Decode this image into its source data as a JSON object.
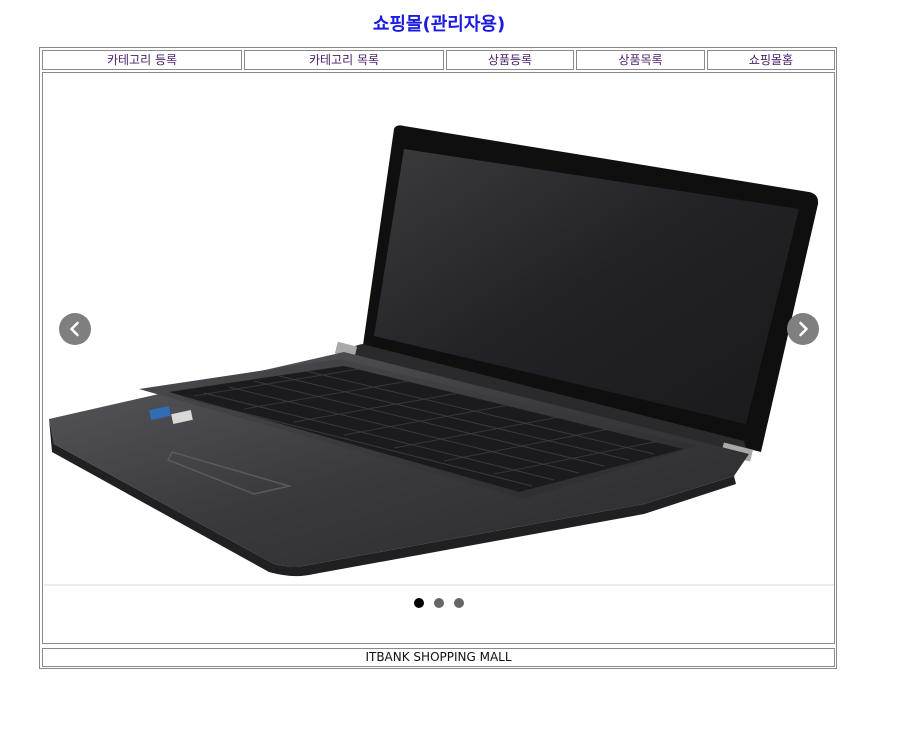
{
  "header": {
    "title": "쇼핑몰(관리자용)"
  },
  "nav": {
    "items": [
      {
        "label": "카테고리 등록"
      },
      {
        "label": "카테고리 목록"
      },
      {
        "label": "상품등록"
      },
      {
        "label": "상품목록"
      },
      {
        "label": "쇼핑몰홈"
      }
    ]
  },
  "carousel": {
    "slide_image": "laptop-image",
    "prev_icon": "chevron-left-icon",
    "next_icon": "chevron-right-icon",
    "indicator_count": 3,
    "active_index": 0
  },
  "footer": {
    "text": "ITBANK SHOPPING MALL"
  },
  "colors": {
    "title": "#1a1ae0",
    "nav_text": "#4b1e6b",
    "border": "#8a8a8a",
    "arrow_bg": "#7f7f7f",
    "dot_active": "#000000",
    "dot_inactive": "#666666"
  }
}
